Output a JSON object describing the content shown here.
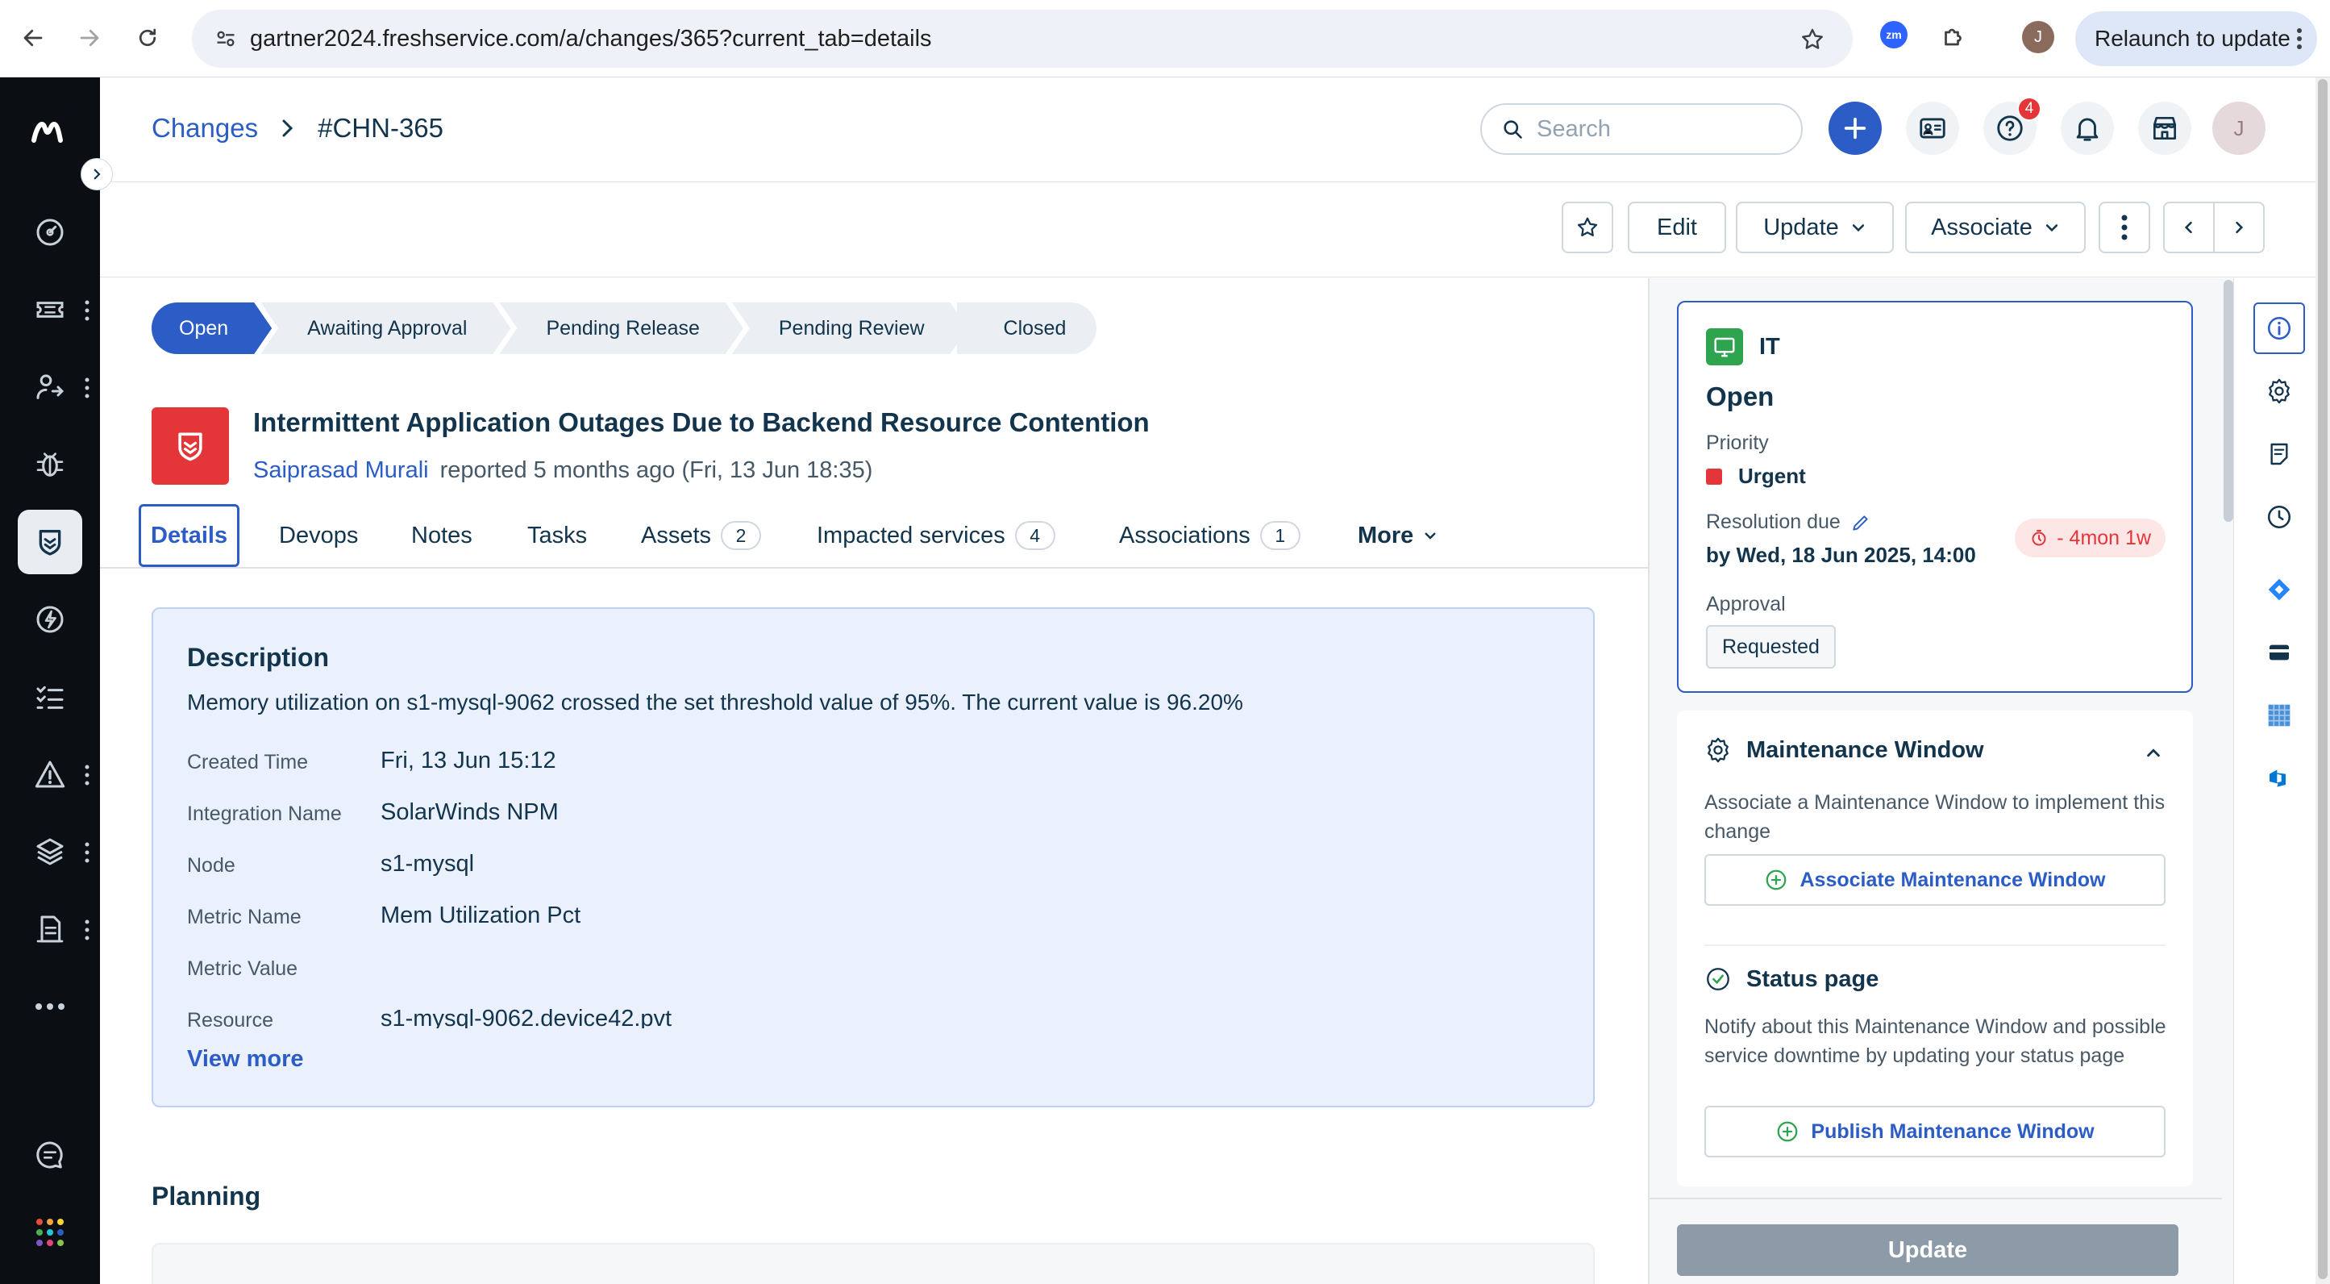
{
  "browser": {
    "url": "gartner2024.freshservice.com/a/changes/365?current_tab=details",
    "zm_label": "zm",
    "profile_initial": "J",
    "relaunch_label": "Relaunch to update"
  },
  "header": {
    "breadcrumb_parent": "Changes",
    "breadcrumb_current": "#CHN-365",
    "search_placeholder": "Search",
    "help_badge": "4",
    "user_initial": "J"
  },
  "toolbar": {
    "edit_label": "Edit",
    "update_label": "Update",
    "associate_label": "Associate"
  },
  "status_flow": [
    {
      "label": "Open",
      "active": true
    },
    {
      "label": "Awaiting Approval",
      "active": false
    },
    {
      "label": "Pending Release",
      "active": false
    },
    {
      "label": "Pending Review",
      "active": false
    },
    {
      "label": "Closed",
      "active": false
    }
  ],
  "ticket": {
    "title": "Intermittent Application Outages Due to Backend Resource Contention",
    "reporter": "Saiprasad Murali",
    "reported_text": "reported 5 months ago (Fri, 13 Jun 18:35)"
  },
  "tabs": [
    {
      "label": "Details",
      "count": null
    },
    {
      "label": "Devops",
      "count": null
    },
    {
      "label": "Notes",
      "count": null
    },
    {
      "label": "Tasks",
      "count": null
    },
    {
      "label": "Assets",
      "count": "2"
    },
    {
      "label": "Impacted services",
      "count": "4"
    },
    {
      "label": "Associations",
      "count": "1"
    },
    {
      "label": "More",
      "count": null
    }
  ],
  "description": {
    "heading": "Description",
    "text": "Memory utilization on s1-mysql-9062 crossed the set threshold value of 95%. The current value is 96.20%",
    "fields": [
      {
        "label": "Created Time",
        "value": "Fri, 13 Jun 15:12"
      },
      {
        "label": "Integration Name",
        "value": "SolarWinds NPM"
      },
      {
        "label": "Node",
        "value": "s1-mysql"
      },
      {
        "label": "Metric Name",
        "value": "Mem Utilization Pct"
      },
      {
        "label": "Metric Value",
        "value": ""
      },
      {
        "label": "Resource",
        "value": "s1-mysql-9062.device42.pvt"
      }
    ],
    "view_more": "View more"
  },
  "planning": {
    "heading": "Planning"
  },
  "properties": {
    "department": "IT",
    "state": "Open",
    "priority_label": "Priority",
    "priority_value": "Urgent",
    "resolution_label": "Resolution due",
    "resolution_value": "by Wed, 18 Jun 2025, 14:00",
    "overdue": "- 4mon 1w",
    "approval_label": "Approval",
    "approval_value": "Requested"
  },
  "maintenance": {
    "heading": "Maintenance Window",
    "text": "Associate a Maintenance Window to implement this change",
    "button": "Associate Maintenance Window"
  },
  "status_page": {
    "heading": "Status page",
    "text": "Notify about this Maintenance Window and possible service downtime by updating your status page",
    "button": "Publish Maintenance Window"
  },
  "panel": {
    "update_button": "Update"
  },
  "colors": {
    "primary": "#2c5cc5",
    "urgent": "#e43538",
    "nav_bg": "#0b0f14",
    "description_bg": "#eaf1fd"
  }
}
